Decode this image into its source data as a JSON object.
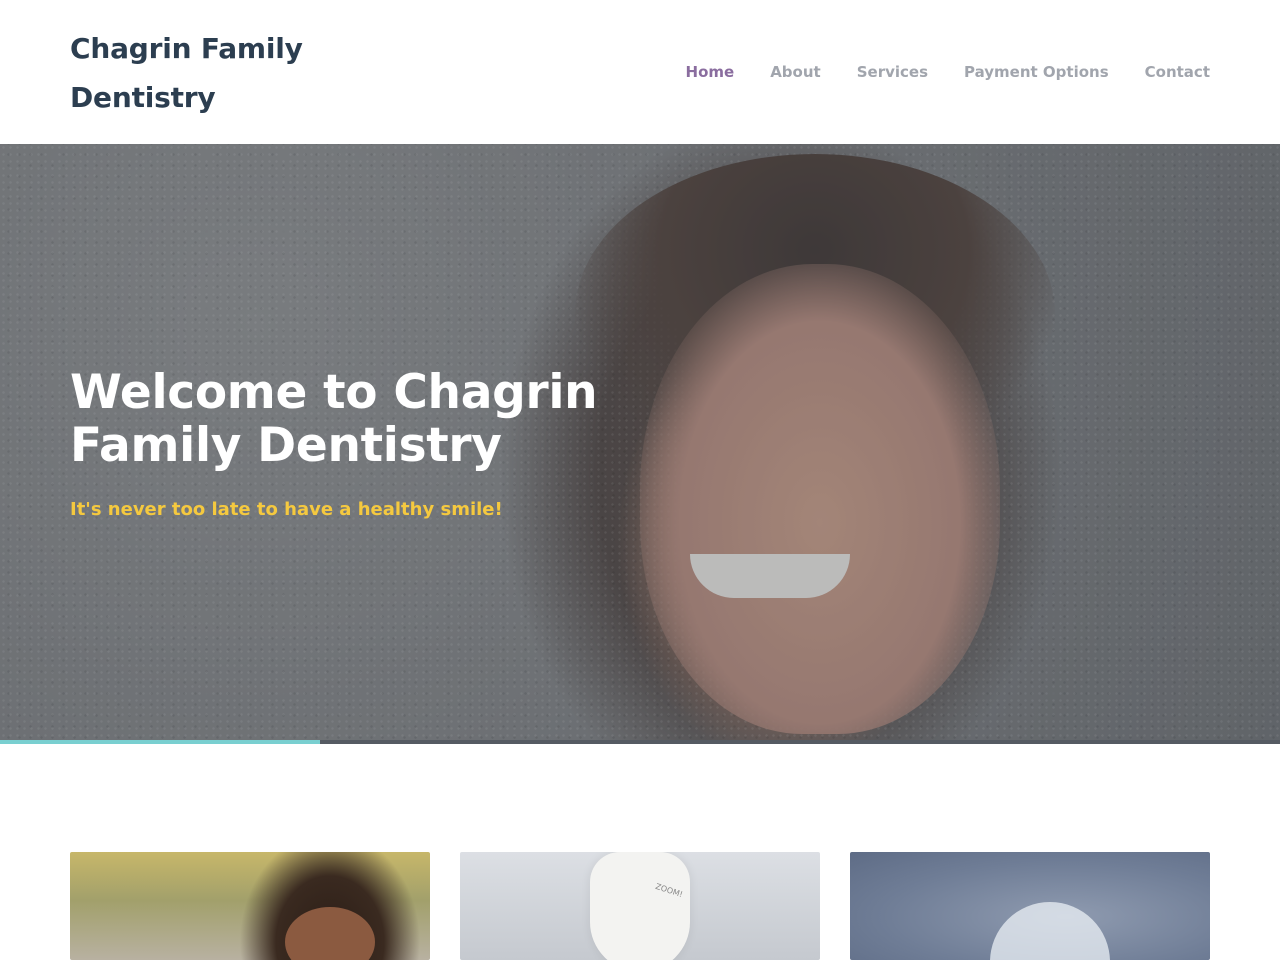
{
  "header": {
    "logo_text": "Chagrin Family Dentistry",
    "nav": [
      {
        "label": "Home",
        "active": true
      },
      {
        "label": "About",
        "active": false
      },
      {
        "label": "Services",
        "active": false
      },
      {
        "label": "Payment Options",
        "active": false
      },
      {
        "label": "Contact",
        "active": false
      }
    ]
  },
  "hero": {
    "title": "Welcome to Chagrin Family Dentistry",
    "subtitle": "It's never too late to have a healthy smile!",
    "slider_progress": 0.25
  },
  "cards": [
    {
      "image": "child-smiling-photo"
    },
    {
      "image": "zoom-whitening-device-photo",
      "label": "ZOOM!"
    },
    {
      "image": "clear-aligner-photo"
    }
  ],
  "colors": {
    "nav_active": "#8a6d9f",
    "nav_inactive": "#a1a5ad",
    "heading": "#2c3e50",
    "subtitle": "#f5c93f",
    "slider_fill": "#79cfd0"
  }
}
